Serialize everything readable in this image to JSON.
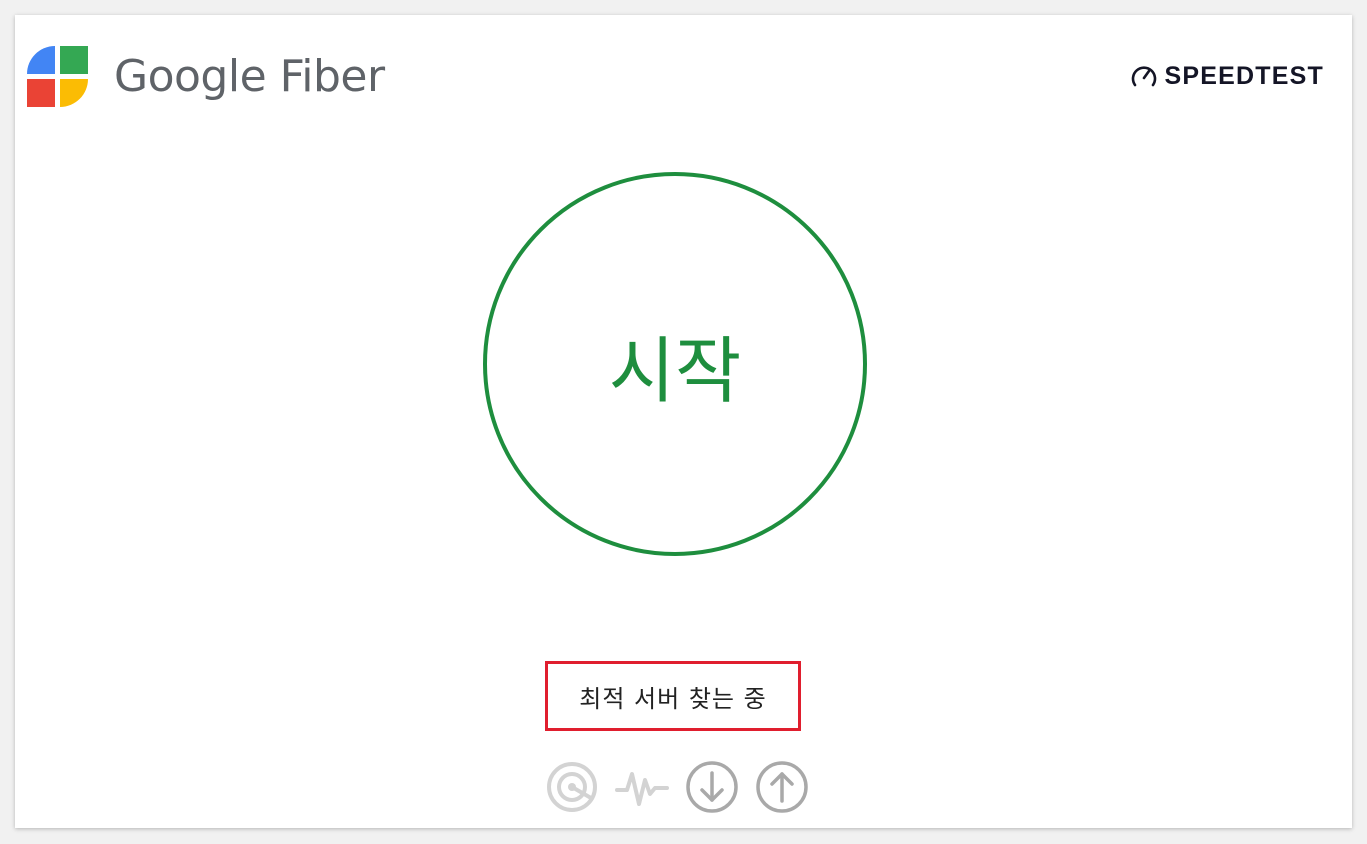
{
  "brand": {
    "name": "Google Fiber",
    "colors": {
      "blue": "#4285f4",
      "green": "#34a853",
      "red": "#ea4335",
      "yellow": "#fbbc04",
      "text": "#5f6368"
    }
  },
  "speedtest": {
    "label": "SPEEDTEST",
    "icon": "speedometer-icon"
  },
  "start": {
    "label": "시작",
    "color": "#1e8e3e"
  },
  "status": {
    "text": "최적 서버 찾는 중",
    "highlight_color": "#e01e2e"
  },
  "steps": [
    {
      "icon": "ping-icon",
      "color": "#d3d3d3"
    },
    {
      "icon": "jitter-icon",
      "color": "#d3d3d3"
    },
    {
      "icon": "download-icon",
      "color": "#a9a9a9"
    },
    {
      "icon": "upload-icon",
      "color": "#a9a9a9"
    }
  ]
}
